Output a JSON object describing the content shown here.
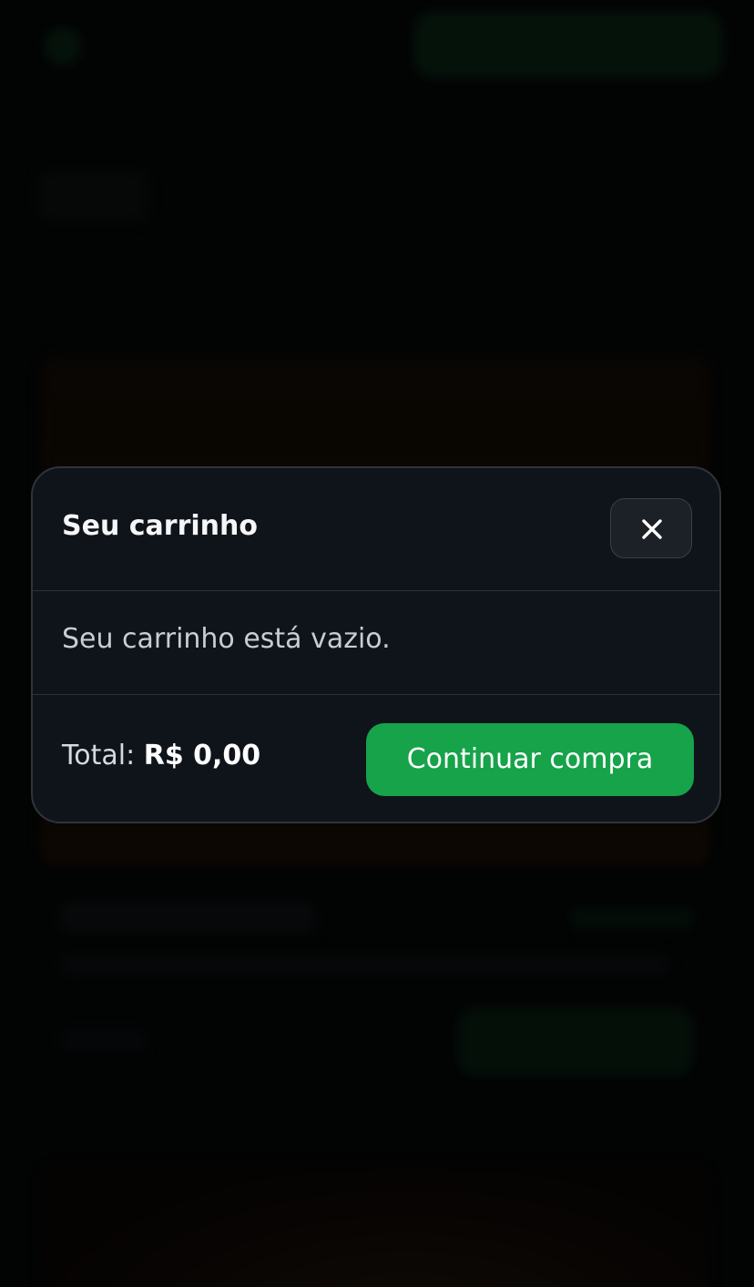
{
  "modal": {
    "title": "Seu carrinho",
    "empty_message": "Seu carrinho está vazio.",
    "total_label": "Total:",
    "total_value": "R$ 0,00",
    "continue_label": "Continuar compra",
    "close_icon": "close-icon"
  },
  "colors": {
    "accent": "#16a34a",
    "modal_bg": "#0f131a",
    "modal_border": "#2f343c"
  }
}
